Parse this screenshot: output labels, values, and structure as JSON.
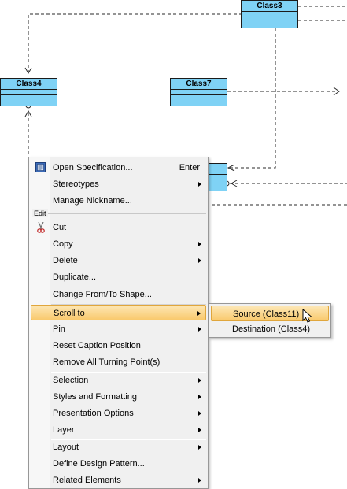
{
  "diagram": {
    "classes": [
      {
        "id": "class3",
        "name": "Class3"
      },
      {
        "id": "class4",
        "name": "Class4"
      },
      {
        "id": "class7",
        "name": "Class7"
      },
      {
        "id": "class11",
        "name": ""
      }
    ],
    "colors": {
      "class_fill": "#7fd2f5",
      "class_border": "#1b1b1b",
      "connector": "#2a2a2a"
    }
  },
  "context_menu": {
    "items": [
      {
        "label": "Open Specification...",
        "shortcut": "Enter",
        "icon": "specification-icon"
      },
      {
        "label": "Stereotypes",
        "submenu": true
      },
      {
        "label": "Manage Nickname..."
      },
      {
        "group": "Edit"
      },
      {
        "label": "Cut",
        "icon": "scissors-icon"
      },
      {
        "label": "Copy",
        "submenu": true
      },
      {
        "label": "Delete",
        "submenu": true
      },
      {
        "label": "Duplicate..."
      },
      {
        "label": "Change From/To Shape..."
      },
      {
        "label": "Scroll to",
        "submenu": true,
        "highlighted": true
      },
      {
        "label": "Pin",
        "submenu": true
      },
      {
        "label": "Reset Caption Position"
      },
      {
        "label": "Remove All Turning Point(s)"
      },
      {
        "label": "Selection",
        "submenu": true
      },
      {
        "label": "Styles and Formatting",
        "submenu": true
      },
      {
        "label": "Presentation Options",
        "submenu": true
      },
      {
        "label": "Layer",
        "submenu": true
      },
      {
        "label": "Layout",
        "submenu": true
      },
      {
        "label": "Define Design Pattern..."
      },
      {
        "label": "Related Elements",
        "submenu": true
      }
    ],
    "highlight_color": "#f9c96d"
  },
  "submenu": {
    "items": [
      {
        "label": "Source (Class11)",
        "highlighted": true
      },
      {
        "label": "Destination (Class4)"
      }
    ]
  }
}
